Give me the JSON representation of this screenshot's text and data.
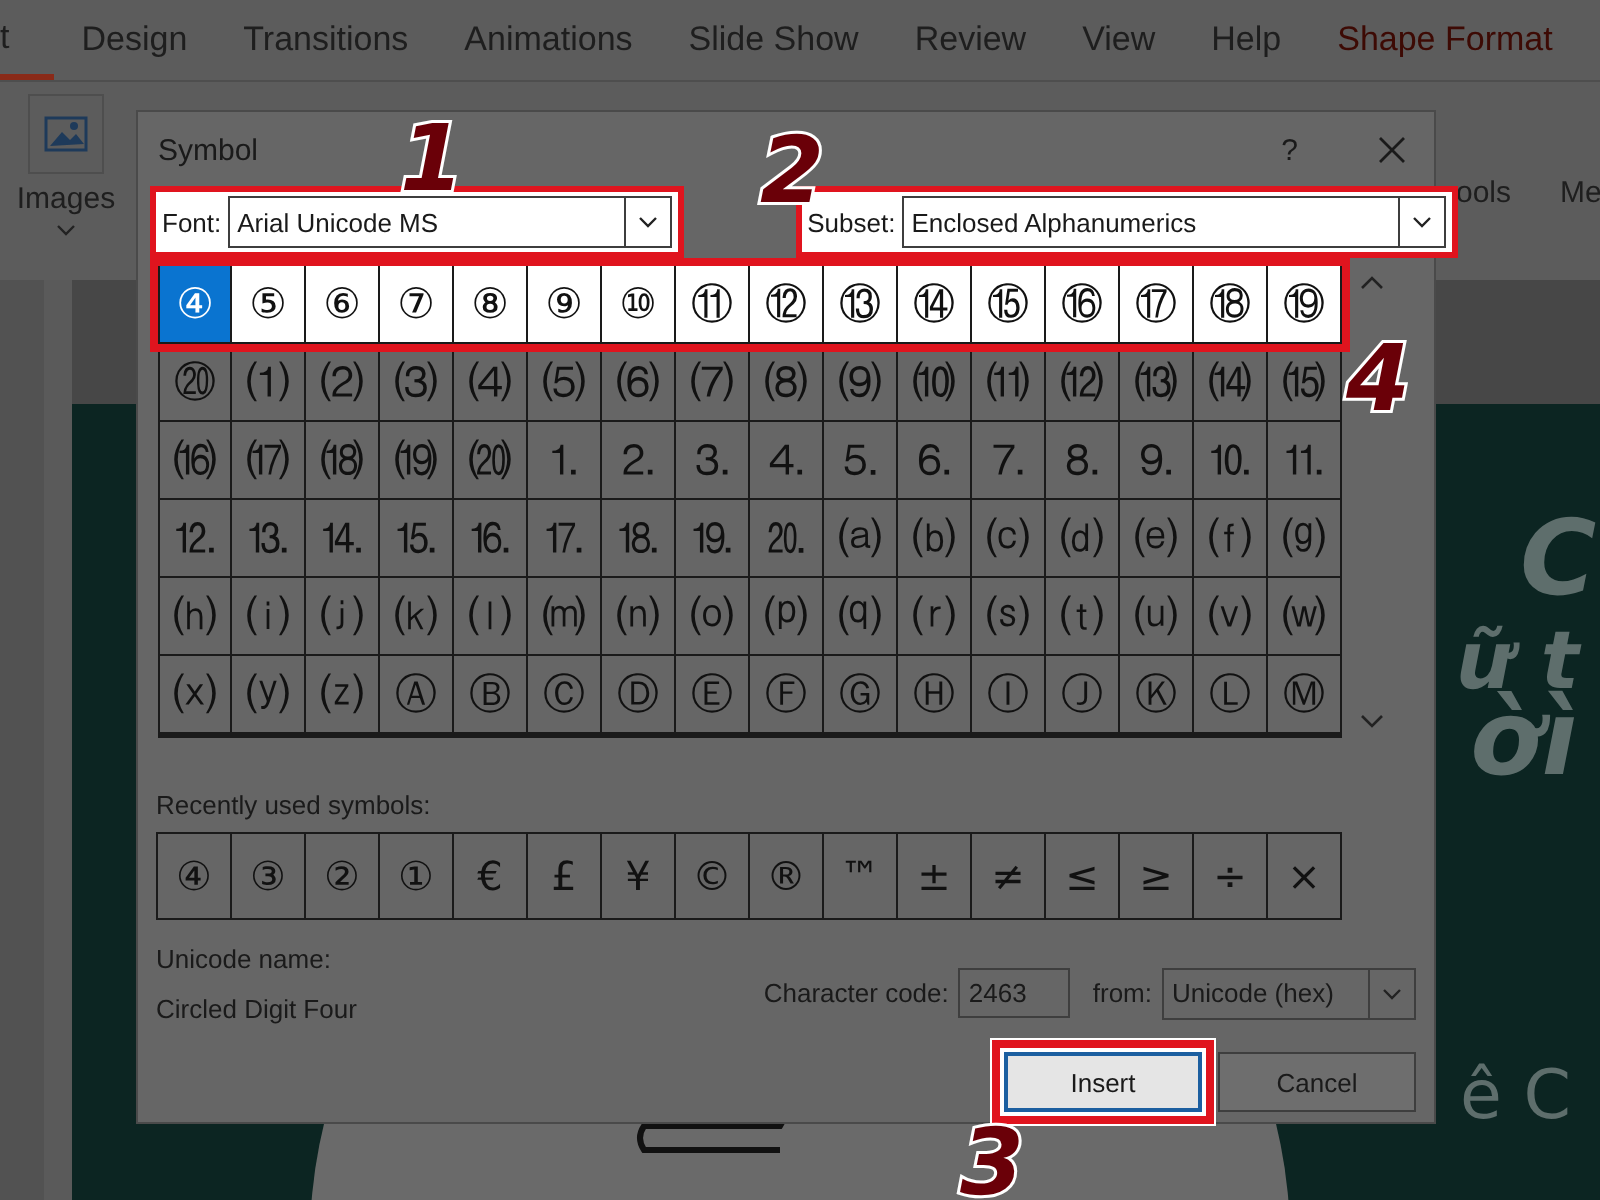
{
  "ribbon": {
    "tabs": [
      {
        "label": "t",
        "selected": true,
        "kind": "tab"
      },
      {
        "label": "Design",
        "selected": false,
        "kind": "tab"
      },
      {
        "label": "Transitions",
        "selected": false,
        "kind": "tab"
      },
      {
        "label": "Animations",
        "selected": false,
        "kind": "tab"
      },
      {
        "label": "Slide Show",
        "selected": false,
        "kind": "tab"
      },
      {
        "label": "Review",
        "selected": false,
        "kind": "tab"
      },
      {
        "label": "View",
        "selected": false,
        "kind": "tab"
      },
      {
        "label": "Help",
        "selected": false,
        "kind": "tab"
      },
      {
        "label": "Shape Format",
        "selected": false,
        "kind": "contextual"
      }
    ],
    "images_label": "Images",
    "right_labels": [
      "ools",
      "Me"
    ]
  },
  "slide": {
    "texts": [
      "C",
      "ữ t",
      "ờì",
      "ê C"
    ]
  },
  "dialog": {
    "title": "Symbol",
    "help": "?",
    "font": {
      "label": "Font:",
      "value": "Arial Unicode MS",
      "highlighted": true
    },
    "subset": {
      "label": "Subset:",
      "value": "Enclosed Alphanumerics",
      "highlighted": true
    },
    "grid": {
      "rows": [
        {
          "highlighted": true,
          "cells": [
            {
              "c": "④",
              "selected": true
            },
            {
              "c": "⑤",
              "selected": false
            },
            {
              "c": "⑥",
              "selected": false
            },
            {
              "c": "⑦",
              "selected": false
            },
            {
              "c": "⑧",
              "selected": false
            },
            {
              "c": "⑨",
              "selected": false
            },
            {
              "c": "⑩",
              "selected": false
            },
            {
              "c": "⑪",
              "selected": false
            },
            {
              "c": "⑫",
              "selected": false
            },
            {
              "c": "⑬",
              "selected": false
            },
            {
              "c": "⑭",
              "selected": false
            },
            {
              "c": "⑮",
              "selected": false
            },
            {
              "c": "⑯",
              "selected": false
            },
            {
              "c": "⑰",
              "selected": false
            },
            {
              "c": "⑱",
              "selected": false
            },
            {
              "c": "⑲",
              "selected": false
            }
          ]
        },
        {
          "highlighted": false,
          "cells": [
            {
              "c": "⑳",
              "selected": false
            },
            {
              "c": "⑴",
              "selected": false
            },
            {
              "c": "⑵",
              "selected": false
            },
            {
              "c": "⑶",
              "selected": false
            },
            {
              "c": "⑷",
              "selected": false
            },
            {
              "c": "⑸",
              "selected": false
            },
            {
              "c": "⑹",
              "selected": false
            },
            {
              "c": "⑺",
              "selected": false
            },
            {
              "c": "⑻",
              "selected": false
            },
            {
              "c": "⑼",
              "selected": false
            },
            {
              "c": "⑽",
              "selected": false
            },
            {
              "c": "⑾",
              "selected": false
            },
            {
              "c": "⑿",
              "selected": false
            },
            {
              "c": "⒀",
              "selected": false
            },
            {
              "c": "⒁",
              "selected": false
            },
            {
              "c": "⒂",
              "selected": false
            }
          ]
        },
        {
          "highlighted": false,
          "cells": [
            {
              "c": "⒃",
              "selected": false
            },
            {
              "c": "⒄",
              "selected": false
            },
            {
              "c": "⒅",
              "selected": false
            },
            {
              "c": "⒆",
              "selected": false
            },
            {
              "c": "⒇",
              "selected": false
            },
            {
              "c": "⒈",
              "selected": false
            },
            {
              "c": "⒉",
              "selected": false
            },
            {
              "c": "⒊",
              "selected": false
            },
            {
              "c": "⒋",
              "selected": false
            },
            {
              "c": "⒌",
              "selected": false
            },
            {
              "c": "⒍",
              "selected": false
            },
            {
              "c": "⒎",
              "selected": false
            },
            {
              "c": "⒏",
              "selected": false
            },
            {
              "c": "⒐",
              "selected": false
            },
            {
              "c": "⒑",
              "selected": false
            },
            {
              "c": "⒒",
              "selected": false
            }
          ]
        },
        {
          "highlighted": false,
          "cells": [
            {
              "c": "⒓",
              "selected": false
            },
            {
              "c": "⒔",
              "selected": false
            },
            {
              "c": "⒕",
              "selected": false
            },
            {
              "c": "⒖",
              "selected": false
            },
            {
              "c": "⒗",
              "selected": false
            },
            {
              "c": "⒘",
              "selected": false
            },
            {
              "c": "⒙",
              "selected": false
            },
            {
              "c": "⒚",
              "selected": false
            },
            {
              "c": "⒛",
              "selected": false
            },
            {
              "c": "⒜",
              "selected": false
            },
            {
              "c": "⒝",
              "selected": false
            },
            {
              "c": "⒞",
              "selected": false
            },
            {
              "c": "⒟",
              "selected": false
            },
            {
              "c": "⒠",
              "selected": false
            },
            {
              "c": "⒡",
              "selected": false
            },
            {
              "c": "⒢",
              "selected": false
            }
          ]
        },
        {
          "highlighted": false,
          "cells": [
            {
              "c": "⒣",
              "selected": false
            },
            {
              "c": "⒤",
              "selected": false
            },
            {
              "c": "⒥",
              "selected": false
            },
            {
              "c": "⒦",
              "selected": false
            },
            {
              "c": "⒧",
              "selected": false
            },
            {
              "c": "⒨",
              "selected": false
            },
            {
              "c": "⒩",
              "selected": false
            },
            {
              "c": "⒪",
              "selected": false
            },
            {
              "c": "⒫",
              "selected": false
            },
            {
              "c": "⒬",
              "selected": false
            },
            {
              "c": "⒭",
              "selected": false
            },
            {
              "c": "⒮",
              "selected": false
            },
            {
              "c": "⒯",
              "selected": false
            },
            {
              "c": "⒰",
              "selected": false
            },
            {
              "c": "⒱",
              "selected": false
            },
            {
              "c": "⒲",
              "selected": false
            }
          ]
        },
        {
          "highlighted": false,
          "cells": [
            {
              "c": "⒳",
              "selected": false
            },
            {
              "c": "⒴",
              "selected": false
            },
            {
              "c": "⒵",
              "selected": false
            },
            {
              "c": "Ⓐ",
              "selected": false
            },
            {
              "c": "Ⓑ",
              "selected": false
            },
            {
              "c": "Ⓒ",
              "selected": false
            },
            {
              "c": "Ⓓ",
              "selected": false
            },
            {
              "c": "Ⓔ",
              "selected": false
            },
            {
              "c": "Ⓕ",
              "selected": false
            },
            {
              "c": "Ⓖ",
              "selected": false
            },
            {
              "c": "Ⓗ",
              "selected": false
            },
            {
              "c": "Ⓘ",
              "selected": false
            },
            {
              "c": "Ⓙ",
              "selected": false
            },
            {
              "c": "Ⓚ",
              "selected": false
            },
            {
              "c": "Ⓛ",
              "selected": false
            },
            {
              "c": "Ⓜ",
              "selected": false
            }
          ]
        }
      ]
    },
    "recent": {
      "label": "Recently used symbols:",
      "symbols": [
        "④",
        "③",
        "②",
        "①",
        "€",
        "£",
        "¥",
        "©",
        "®",
        "™",
        "±",
        "≠",
        "≤",
        "≥",
        "÷",
        "×"
      ]
    },
    "unicode_name": {
      "label": "Unicode name:",
      "value": "Circled Digit Four"
    },
    "character_code": {
      "label": "Character code:",
      "value": "2463"
    },
    "from": {
      "label": "from:",
      "value": "Unicode (hex)"
    },
    "buttons": [
      {
        "label": "Insert",
        "kind": "default",
        "highlighted": true
      },
      {
        "label": "Cancel",
        "kind": "normal",
        "highlighted": false
      }
    ]
  },
  "callouts": [
    {
      "label": "1"
    },
    {
      "label": "2"
    },
    {
      "label": "3"
    },
    {
      "label": "4"
    }
  ]
}
